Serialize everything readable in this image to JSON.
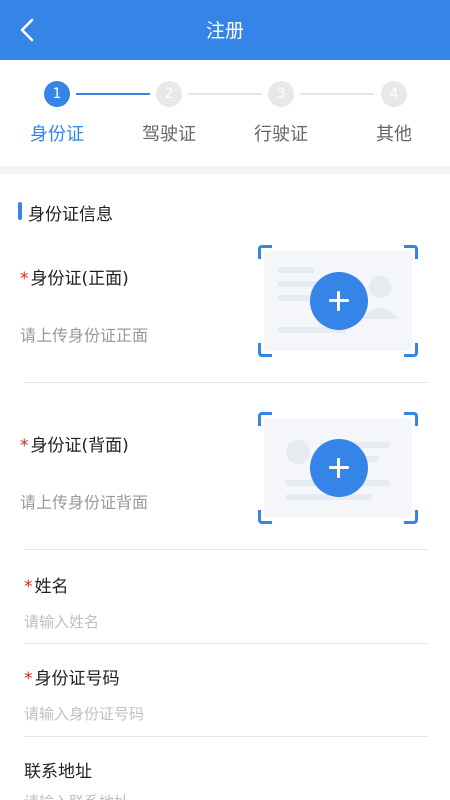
{
  "nav": {
    "title": "注册"
  },
  "steps": [
    {
      "num": "1",
      "label": "身份证"
    },
    {
      "num": "2",
      "label": "驾驶证"
    },
    {
      "num": "3",
      "label": "行驶证"
    },
    {
      "num": "4",
      "label": "其他"
    }
  ],
  "current_step": 1,
  "section": {
    "title": "身份证信息"
  },
  "required_mark": "*",
  "uploads": {
    "front": {
      "label": "身份证(正面)",
      "hint": "请上传身份证正面"
    },
    "back": {
      "label": "身份证(背面)",
      "hint": "请上传身份证背面"
    }
  },
  "fields": {
    "name": {
      "label": "姓名",
      "placeholder": "请输入姓名",
      "required": true,
      "value": ""
    },
    "id_number": {
      "label": "身份证号码",
      "placeholder": "请输入身份证号码",
      "required": true,
      "value": ""
    },
    "address": {
      "label": "联系地址",
      "placeholder": "请输入联系地址",
      "required": false,
      "value": ""
    }
  },
  "colors": {
    "primary": "#3585e8",
    "required": "#e02020",
    "inactive_step": "#e8e8e8"
  },
  "icons": {
    "back": "chevron-left-icon",
    "add": "plus-icon"
  }
}
